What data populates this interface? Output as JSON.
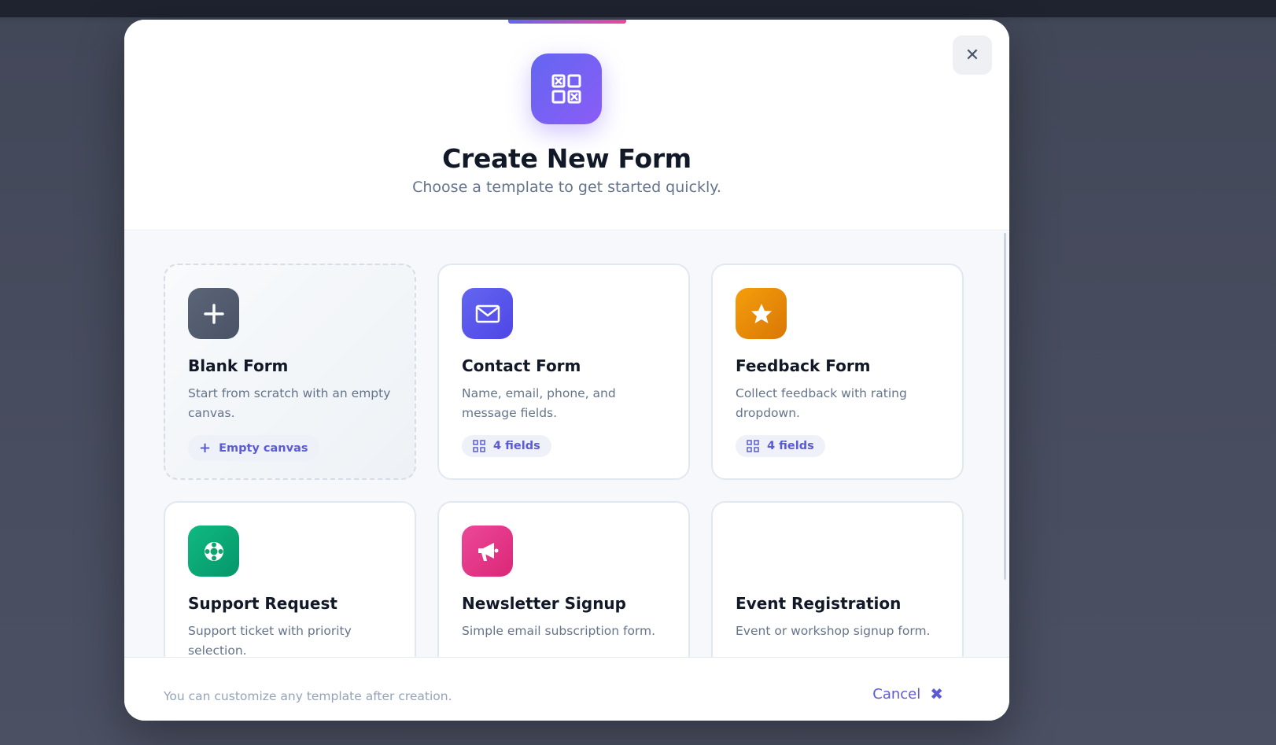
{
  "modal": {
    "title": "Create New Form",
    "subtitle": "Choose a template to get started quickly.",
    "close_icon": "close-icon",
    "header_icon": "grid-icon"
  },
  "templates": [
    {
      "title": "Blank Form",
      "description": "Start from scratch with an empty canvas.",
      "badge": "Empty canvas",
      "icon": "plus-icon",
      "color": "#5b6578",
      "badge_icon": "plus-icon"
    },
    {
      "title": "Contact Form",
      "description": "Name, email, phone, and message fields.",
      "badge": "4 fields",
      "icon": "mail-icon",
      "color": "#6366f1",
      "badge_icon": "grid-icon"
    },
    {
      "title": "Feedback Form",
      "description": "Collect feedback with rating dropdown.",
      "badge": "4 fields",
      "icon": "star-icon",
      "color": "#ea8a0b",
      "badge_icon": "grid-icon"
    },
    {
      "title": "Support Request",
      "description": "Support ticket with priority selection.",
      "badge": "",
      "icon": "lifebuoy-icon",
      "color": "#10a56f",
      "badge_icon": "grid-icon"
    },
    {
      "title": "Newsletter Signup",
      "description": "Simple email subscription form.",
      "badge": "",
      "icon": "megaphone-icon",
      "color": "#ec4899",
      "badge_icon": "grid-icon"
    },
    {
      "title": "Event Registration",
      "description": "Event or workshop signup form.",
      "badge": "",
      "icon": "",
      "color": "",
      "badge_icon": "grid-icon"
    }
  ],
  "footer": {
    "note": "You can customize any template after creation.",
    "cancel_label": "Cancel"
  }
}
